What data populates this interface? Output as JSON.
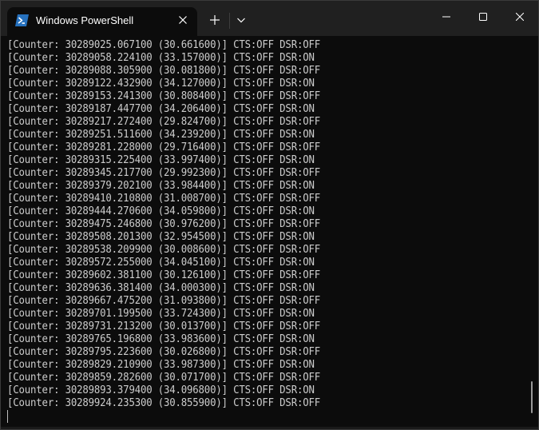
{
  "window": {
    "tab_title": "Windows PowerShell"
  },
  "terminal": {
    "lines": [
      "[Counter: 30289025.067100 (30.661600)] CTS:OFF DSR:OFF",
      "[Counter: 30289058.224100 (33.157000)] CTS:OFF DSR:ON",
      "[Counter: 30289088.305900 (30.081800)] CTS:OFF DSR:OFF",
      "[Counter: 30289122.432900 (34.127000)] CTS:OFF DSR:ON",
      "[Counter: 30289153.241300 (30.808400)] CTS:OFF DSR:OFF",
      "[Counter: 30289187.447700 (34.206400)] CTS:OFF DSR:ON",
      "[Counter: 30289217.272400 (29.824700)] CTS:OFF DSR:OFF",
      "[Counter: 30289251.511600 (34.239200)] CTS:OFF DSR:ON",
      "[Counter: 30289281.228000 (29.716400)] CTS:OFF DSR:OFF",
      "[Counter: 30289315.225400 (33.997400)] CTS:OFF DSR:ON",
      "[Counter: 30289345.217700 (29.992300)] CTS:OFF DSR:OFF",
      "[Counter: 30289379.202100 (33.984400)] CTS:OFF DSR:ON",
      "[Counter: 30289410.210800 (31.008700)] CTS:OFF DSR:OFF",
      "[Counter: 30289444.270600 (34.059800)] CTS:OFF DSR:ON",
      "[Counter: 30289475.246800 (30.976200)] CTS:OFF DSR:OFF",
      "[Counter: 30289508.201300 (32.954500)] CTS:OFF DSR:ON",
      "[Counter: 30289538.209900 (30.008600)] CTS:OFF DSR:OFF",
      "[Counter: 30289572.255000 (34.045100)] CTS:OFF DSR:ON",
      "[Counter: 30289602.381100 (30.126100)] CTS:OFF DSR:OFF",
      "[Counter: 30289636.381400 (34.000300)] CTS:OFF DSR:ON",
      "[Counter: 30289667.475200 (31.093800)] CTS:OFF DSR:OFF",
      "[Counter: 30289701.199500 (33.724300)] CTS:OFF DSR:ON",
      "[Counter: 30289731.213200 (30.013700)] CTS:OFF DSR:OFF",
      "[Counter: 30289765.196800 (33.983600)] CTS:OFF DSR:ON",
      "[Counter: 30289795.223600 (30.026800)] CTS:OFF DSR:OFF",
      "[Counter: 30289829.210900 (33.987300)] CTS:OFF DSR:ON",
      "[Counter: 30289859.282600 (30.071700)] CTS:OFF DSR:OFF",
      "[Counter: 30289893.379400 (34.096800)] CTS:OFF DSR:ON",
      "[Counter: 30289924.235300 (30.855900)] CTS:OFF DSR:OFF"
    ]
  },
  "icons": {
    "tab": "powershell-icon",
    "close_tab": "close-icon",
    "new_tab": "plus-icon",
    "dropdown": "chevron-down-icon",
    "minimize": "minimize-icon",
    "maximize": "maximize-icon",
    "close_window": "close-icon"
  },
  "colors": {
    "titlebar": "#202020",
    "terminal_bg": "#0c0c0c",
    "terminal_fg": "#cccccc",
    "powershell_blue": "#2671be"
  }
}
